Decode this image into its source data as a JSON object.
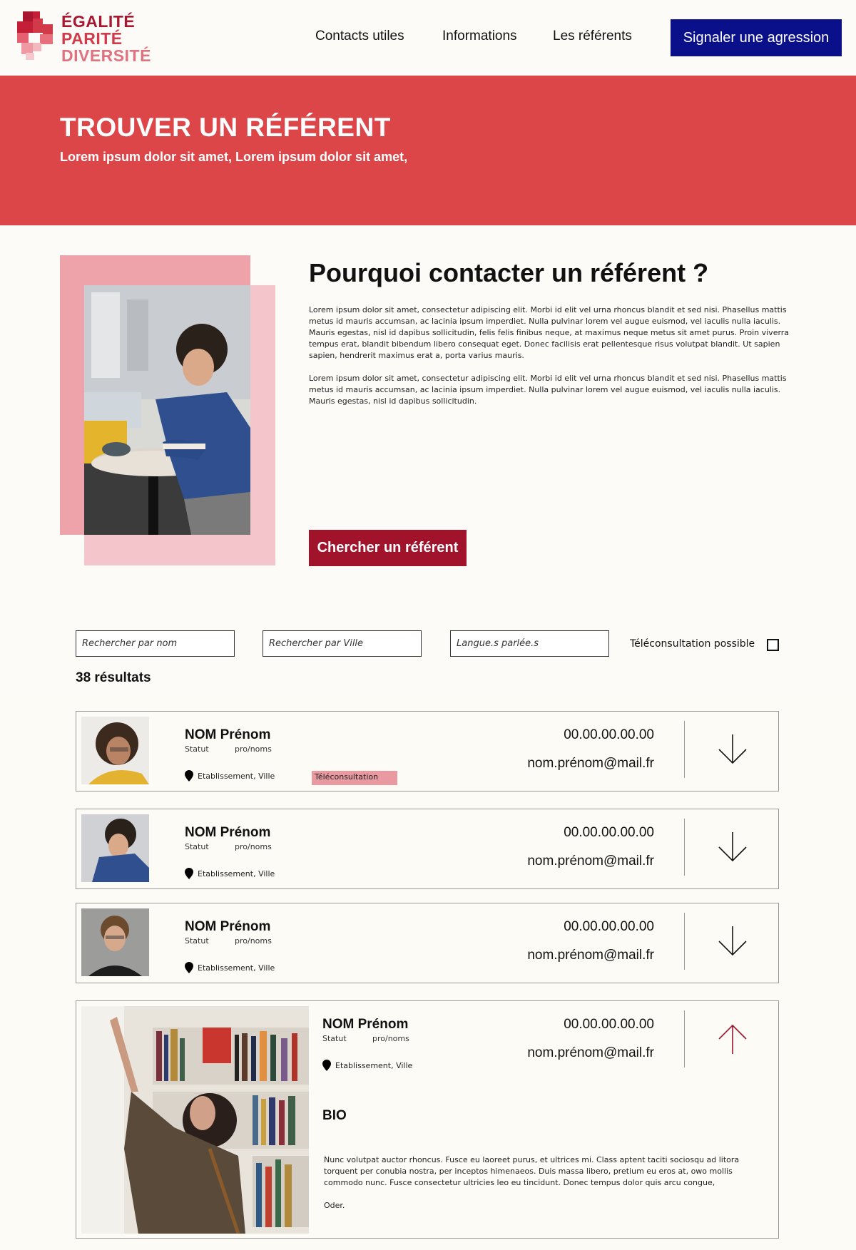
{
  "header": {
    "logo": [
      "ÉGALITÉ",
      "PARITÉ",
      "DIVERSITÉ"
    ],
    "nav": [
      "Contacts utiles",
      "Informations",
      "Les référents"
    ],
    "cta": "Signaler une agression"
  },
  "hero": {
    "title": "TROUVER UN RÉFÉRENT",
    "subtitle": "Lorem ipsum dolor sit amet, Lorem ipsum dolor sit amet,"
  },
  "intro": {
    "title": "Pourquoi contacter un référent ?",
    "paragraph1": "Lorem ipsum dolor sit amet, consectetur adipiscing elit. Morbi id elit vel urna rhoncus blandit et sed nisi. Phasellus mattis metus id mauris accumsan, ac lacinia ipsum imperdiet. Nulla pulvinar lorem vel augue euismod, vel iaculis nulla iaculis. Mauris egestas, nisl id dapibus sollicitudin, felis felis finibus neque, at maximus neque metus sit amet purus. Proin viverra tempus erat, blandit bibendum libero consequat eget. Donec facilisis erat pellentesque risus volutpat blandit. Ut sapien sapien, hendrerit maximus erat a, porta varius mauris.",
    "paragraph2": "Lorem ipsum dolor sit amet, consectetur adipiscing elit. Morbi id elit vel urna rhoncus blandit et sed nisi. Phasellus mattis metus id mauris accumsan, ac lacinia ipsum imperdiet. Nulla pulvinar lorem vel augue euismod, vel iaculis nulla iaculis. Mauris egestas, nisl id dapibus sollicitudin.",
    "button": "Chercher un référent"
  },
  "filters": {
    "name_placeholder": "Rechercher par nom",
    "city_placeholder": "Rechercher par Ville",
    "lang_placeholder": "Langue.s parlée.s",
    "tele_label": "Téléconsultation possible"
  },
  "results": {
    "count": "38 résultats",
    "items": [
      {
        "name": "NOM Prénom",
        "statut": "Statut",
        "pronoms": "pro/noms",
        "location": "Etablissement, Ville",
        "badge": "Téléconsultation",
        "phone": "00.00.00.00.00",
        "email": "nom.prénom@mail.fr"
      },
      {
        "name": "NOM Prénom",
        "statut": "Statut",
        "pronoms": "pro/noms",
        "location": "Etablissement, Ville",
        "phone": "00.00.00.00.00",
        "email": "nom.prénom@mail.fr"
      },
      {
        "name": "NOM Prénom",
        "statut": "Statut",
        "pronoms": "pro/noms",
        "location": "Etablissement, Ville",
        "phone": "00.00.00.00.00",
        "email": "nom.prénom@mail.fr"
      },
      {
        "name": "NOM Prénom",
        "statut": "Statut",
        "pronoms": "pro/noms",
        "location": "Etablissement, Ville",
        "phone": "00.00.00.00.00",
        "email": "nom.prénom@mail.fr",
        "bio_title": "BIO",
        "bio_text": "Nunc volutpat auctor rhoncus. Fusce eu laoreet purus, et ultrices mi. Class aptent taciti sociosqu ad litora torquent per conubia nostra, per inceptos himenaeos. Duis massa libero, pretium eu eros at, owo mollis commodo nunc. Fusce consectetur ultricies leo eu tincidunt. Donec tempus dolor quis arcu congue,",
        "bio_sign": "Oder."
      }
    ]
  },
  "colors": {
    "hero": "#dd4649",
    "cta": "#0a0f8a",
    "search_button": "#a0132b",
    "badge": "#e99aa1",
    "arrow_expanded": "#a0132b"
  },
  "icons": [
    "pin-icon",
    "arrow-down-icon",
    "arrow-up-icon",
    "checkbox-icon"
  ]
}
